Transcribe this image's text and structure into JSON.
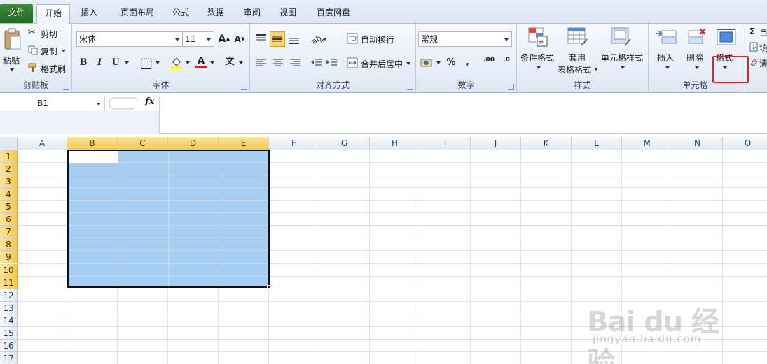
{
  "tabs": [
    {
      "label": "文件"
    },
    {
      "label": "开始"
    },
    {
      "label": "插入"
    },
    {
      "label": "页面布局"
    },
    {
      "label": "公式"
    },
    {
      "label": "数据"
    },
    {
      "label": "审阅"
    },
    {
      "label": "视图"
    },
    {
      "label": "百度网盘"
    }
  ],
  "ribbon": {
    "clipboard": {
      "title": "剪贴板",
      "paste": "粘贴",
      "cut": "剪切",
      "copy": "复制",
      "format_painter": "格式刷"
    },
    "font": {
      "title": "字体",
      "font_name": "宋体",
      "font_size": "11",
      "bold": "B",
      "italic": "I",
      "underline": "U",
      "grow": "A",
      "shrink": "A",
      "phonetic": "文",
      "text_color": "A"
    },
    "alignment": {
      "title": "对齐方式",
      "wrap_text": "自动换行",
      "merge_center": "合并后居中"
    },
    "number": {
      "title": "数字",
      "format": "常规",
      "percent": "%",
      "comma": ",",
      "inc_decimal": ".00",
      "dec_decimal": ".0"
    },
    "styles": {
      "title": "样式",
      "conditional": "条件格式",
      "table_format_1": "套用",
      "table_format_2": "表格格式",
      "cell_styles": "单元格样式"
    },
    "cells": {
      "title": "单元格",
      "insert": "插入",
      "delete": "删除",
      "format": "格式"
    },
    "editing": {
      "sum": "Σ",
      "sum_label": "自",
      "fill_label": "填",
      "clear_label": "清"
    }
  },
  "formula_bar": {
    "name_box": "B1",
    "fx": "fx",
    "value": ""
  },
  "grid": {
    "columns": [
      "A",
      "B",
      "C",
      "D",
      "E",
      "F",
      "G",
      "H",
      "I",
      "J",
      "K",
      "L",
      "M",
      "N",
      "O"
    ],
    "rows": [
      "1",
      "2",
      "3",
      "4",
      "5",
      "6",
      "7",
      "8",
      "9",
      "10",
      "11",
      "12",
      "13",
      "14",
      "15",
      "16",
      "17"
    ],
    "selected_columns": [
      "B",
      "C",
      "D",
      "E"
    ],
    "selected_rows": [
      "1",
      "2",
      "3",
      "4",
      "5",
      "6",
      "7",
      "8",
      "9",
      "10",
      "11"
    ],
    "active_cell": "B1"
  },
  "watermark": {
    "logo": "Bai du 经验",
    "url": "jingyan.baidu.com"
  },
  "colors": {
    "selection_fill": "#a7cdf0",
    "header_selected": "#f5c94f",
    "highlight_box": "#e8221e",
    "file_tab": "#2b7a2b"
  }
}
